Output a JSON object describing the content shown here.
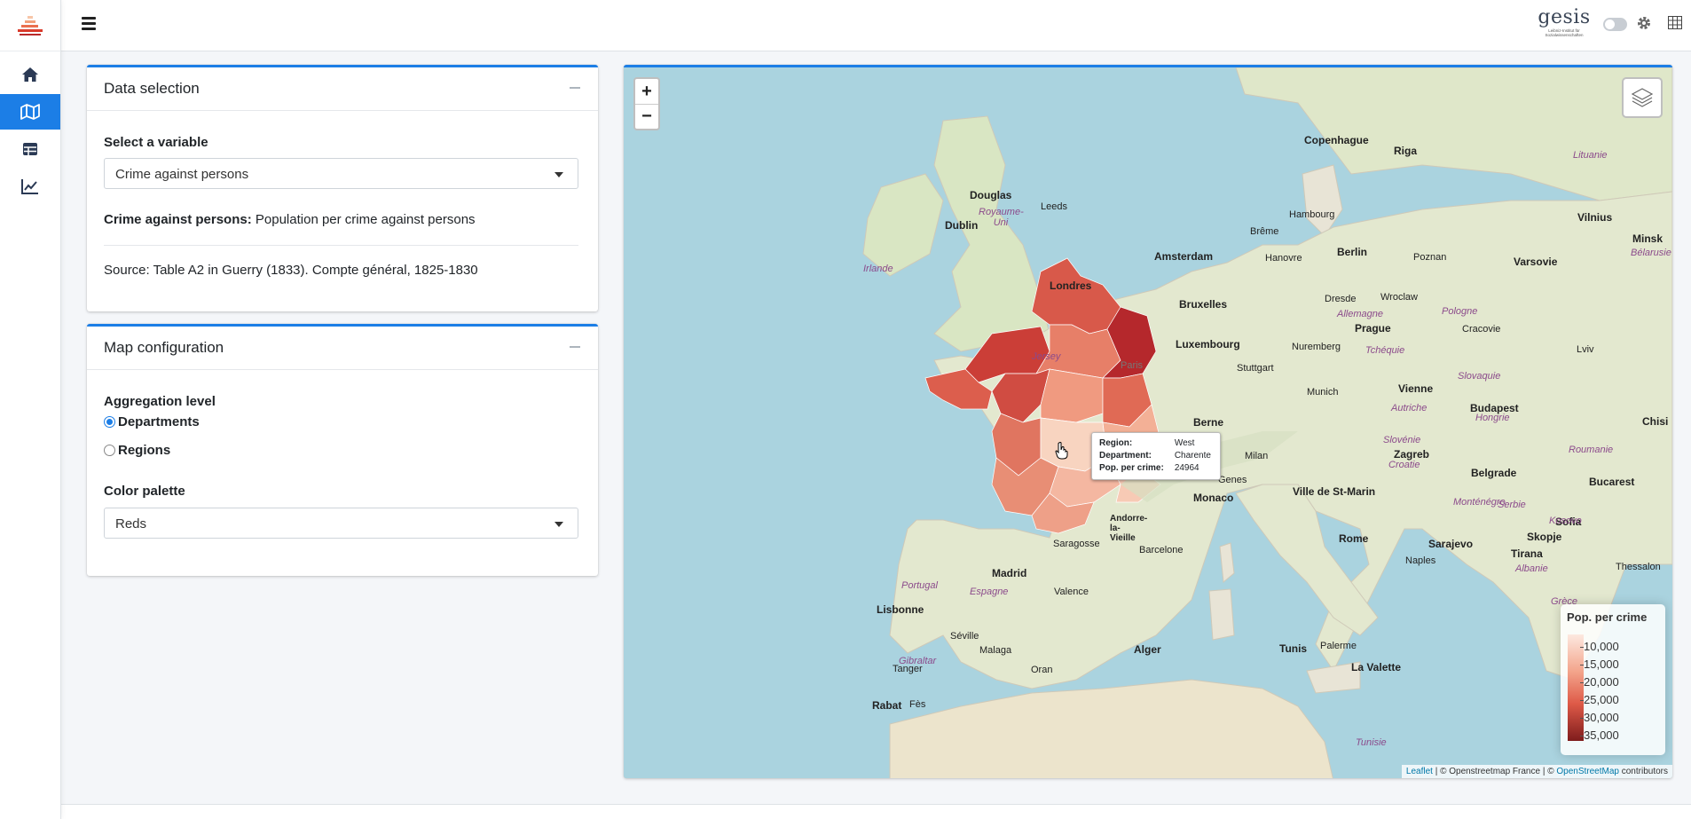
{
  "header": {
    "logo_text": "gesis",
    "logo_subtext": "Leibniz-Institut für Sozialwissenschaften"
  },
  "sidebar": {
    "items": [
      "home",
      "map",
      "table",
      "chart"
    ],
    "active": "map"
  },
  "data_selection": {
    "title": "Data selection",
    "variable_label": "Select a variable",
    "variable_value": "Crime against persons",
    "description_term": "Crime against persons:",
    "description_text": "Population per crime against persons",
    "source": "Source: Table A2 in Guerry (1833). Compte général, 1825-1830"
  },
  "map_config": {
    "title": "Map configuration",
    "aggregation_label": "Aggregation level",
    "options": [
      "Departments",
      "Regions"
    ],
    "selected": "Departments",
    "palette_label": "Color palette",
    "palette_value": "Reds"
  },
  "map": {
    "tooltip": {
      "region_key": "Region:",
      "region": "West",
      "dept_key": "Department:",
      "dept": "Charente",
      "pop_key": "Pop. per crime:",
      "pop": "24964"
    },
    "legend": {
      "title": "Pop. per crime",
      "ticks": [
        "10,000",
        "15,000",
        "20,000",
        "25,000",
        "30,000",
        "35,000"
      ]
    },
    "attribution": {
      "leaflet": "Leaflet",
      "osm_fr": " | © Openstreetmap France | © ",
      "osm": "OpenStreetMap",
      "contrib": " contributors"
    },
    "labels": [
      {
        "t": "Copenhague",
        "c": "cap"
      },
      {
        "t": "Dublin",
        "c": "cap"
      },
      {
        "t": "Douglas",
        "c": "cap"
      },
      {
        "t": "Leeds",
        "c": ""
      },
      {
        "t": "Amsterdam",
        "c": "cap"
      },
      {
        "t": "Londres",
        "c": "cap"
      },
      {
        "t": "Bruxelles",
        "c": "cap"
      },
      {
        "t": "Luxembourg",
        "c": "cap"
      },
      {
        "t": "Hambourg",
        "c": ""
      },
      {
        "t": "Brême",
        "c": ""
      },
      {
        "t": "Hanovre",
        "c": ""
      },
      {
        "t": "Berlin",
        "c": "cap"
      },
      {
        "t": "Poznan",
        "c": ""
      },
      {
        "t": "Varsovie",
        "c": "cap"
      },
      {
        "t": "Dresde",
        "c": ""
      },
      {
        "t": "Wroclaw",
        "c": ""
      },
      {
        "t": "Prague",
        "c": "cap"
      },
      {
        "t": "Cracovie",
        "c": ""
      },
      {
        "t": "Nuremberg",
        "c": ""
      },
      {
        "t": "Stuttgart",
        "c": ""
      },
      {
        "t": "Munich",
        "c": ""
      },
      {
        "t": "Vienne",
        "c": "cap"
      },
      {
        "t": "Budapest",
        "c": "cap"
      },
      {
        "t": "Berne",
        "c": "cap"
      },
      {
        "t": "Milan",
        "c": ""
      },
      {
        "t": "Genes",
        "c": ""
      },
      {
        "t": "Zagreb",
        "c": "cap"
      },
      {
        "t": "Belgrade",
        "c": "cap"
      },
      {
        "t": "Ville de St-Marin",
        "c": "cap"
      },
      {
        "t": "Monaco",
        "c": "cap"
      },
      {
        "t": "Rome",
        "c": "cap"
      },
      {
        "t": "Sarajevo",
        "c": "cap"
      },
      {
        "t": "Bucarest",
        "c": "cap"
      },
      {
        "t": "Sofia",
        "c": "cap"
      },
      {
        "t": "Skopje",
        "c": "cap"
      },
      {
        "t": "Tirana",
        "c": "cap"
      },
      {
        "t": "Naples",
        "c": ""
      },
      {
        "t": "Madrid",
        "c": "cap"
      },
      {
        "t": "Saragosse",
        "c": ""
      },
      {
        "t": "Barcelone",
        "c": ""
      },
      {
        "t": "Andorre-la-Vieille",
        "c": "cap"
      },
      {
        "t": "Valence",
        "c": ""
      },
      {
        "t": "Lisbonne",
        "c": "cap"
      },
      {
        "t": "Séville",
        "c": ""
      },
      {
        "t": "Malaga",
        "c": ""
      },
      {
        "t": "Alger",
        "c": "cap"
      },
      {
        "t": "Tunis",
        "c": "cap"
      },
      {
        "t": "La Valette",
        "c": "cap"
      },
      {
        "t": "Palerme",
        "c": ""
      },
      {
        "t": "Rabat",
        "c": "cap"
      },
      {
        "t": "Fès",
        "c": ""
      },
      {
        "t": "Tanger",
        "c": ""
      },
      {
        "t": "Oran",
        "c": ""
      },
      {
        "t": "Gibraltar",
        "c": ""
      },
      {
        "t": "Riga",
        "c": "cap"
      },
      {
        "t": "Vilnius",
        "c": "cap"
      },
      {
        "t": "Minsk",
        "c": "cap"
      },
      {
        "t": "Chisi",
        "c": "cap"
      },
      {
        "t": "Thessalon",
        "c": ""
      },
      {
        "t": "Lviv",
        "c": ""
      },
      {
        "t": "Irlande",
        "c": "country"
      },
      {
        "t": "Royaume-Uni",
        "c": "country"
      },
      {
        "t": "Allemagne",
        "c": "country"
      },
      {
        "t": "Pologne",
        "c": "country"
      },
      {
        "t": "Tchéquie",
        "c": "country"
      },
      {
        "t": "Slovaquie",
        "c": "country"
      },
      {
        "t": "Autriche",
        "c": "country"
      },
      {
        "t": "Hongrie",
        "c": "country"
      },
      {
        "t": "Slovénie",
        "c": "country"
      },
      {
        "t": "Croatie",
        "c": "country"
      },
      {
        "t": "Serbie",
        "c": "country"
      },
      {
        "t": "Roumanie",
        "c": "country"
      },
      {
        "t": "Bélarusie",
        "c": "country"
      },
      {
        "t": "Lituanie",
        "c": "country"
      },
      {
        "t": "Espagne",
        "c": "country"
      },
      {
        "t": "Portugal",
        "c": "country"
      },
      {
        "t": "Jersey",
        "c": "country"
      },
      {
        "t": "Albanie",
        "c": "country"
      },
      {
        "t": "Kosovo",
        "c": "country"
      },
      {
        "t": "Monténégro",
        "c": "country"
      },
      {
        "t": "Grèce",
        "c": "country"
      },
      {
        "t": "Tunisie",
        "c": "country"
      },
      {
        "t": "Paris",
        "c": ""
      }
    ]
  }
}
